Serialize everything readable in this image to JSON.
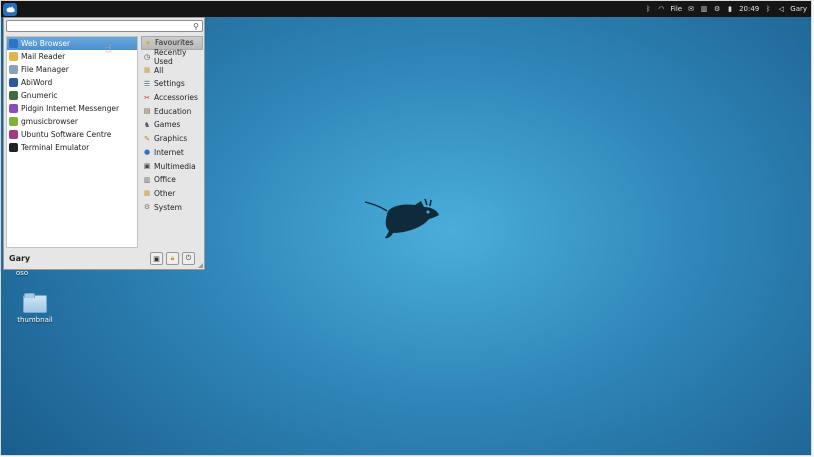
{
  "panel": {
    "menu_icon": "xfce-mouse-icon",
    "tray": {
      "file_label": "File",
      "clock": "20:49",
      "user": "Gary"
    }
  },
  "desktop": {
    "items": [
      {
        "label": "oso"
      },
      {
        "label": "thumbnail"
      }
    ]
  },
  "menu": {
    "search": {
      "value": "",
      "placeholder": ""
    },
    "apps": [
      {
        "label": "Web Browser",
        "icon": "globe-icon",
        "color": "#2f73c4"
      },
      {
        "label": "Mail Reader",
        "icon": "mail-icon",
        "color": "#e3b34a"
      },
      {
        "label": "File Manager",
        "icon": "folder-icon",
        "color": "#8aa1b8"
      },
      {
        "label": "AbiWord",
        "icon": "document-icon",
        "color": "#2b5b9a"
      },
      {
        "label": "Gnumeric",
        "icon": "spreadsheet-icon",
        "color": "#3e6e3e"
      },
      {
        "label": "Pidgin Internet Messenger",
        "icon": "pidgin-icon",
        "color": "#8a4fb5"
      },
      {
        "label": "gmusicbrowser",
        "icon": "music-icon",
        "color": "#7fb03a"
      },
      {
        "label": "Ubuntu Software Centre",
        "icon": "software-centre-icon",
        "color": "#a03a8a"
      },
      {
        "label": "Terminal Emulator",
        "icon": "terminal-icon",
        "color": "#222222"
      }
    ],
    "categories": [
      {
        "label": "Favourites",
        "icon": "star-icon",
        "glyph": "★",
        "color": "#e0a82e"
      },
      {
        "label": "Recently Used",
        "icon": "clock-icon",
        "glyph": "◷",
        "color": "#444444"
      },
      {
        "label": "All",
        "icon": "folder-icon",
        "glyph": "▦",
        "color": "#c9a24a"
      },
      {
        "label": "Settings",
        "icon": "settings-icon",
        "glyph": "☰",
        "color": "#5a6a7a"
      },
      {
        "label": "Accessories",
        "icon": "accessories-icon",
        "glyph": "✂",
        "color": "#c03030"
      },
      {
        "label": "Education",
        "icon": "education-icon",
        "glyph": "▤",
        "color": "#6b5a3a"
      },
      {
        "label": "Games",
        "icon": "games-icon",
        "glyph": "♞",
        "color": "#555555"
      },
      {
        "label": "Graphics",
        "icon": "graphics-icon",
        "glyph": "✎",
        "color": "#c07a20"
      },
      {
        "label": "Internet",
        "icon": "internet-icon",
        "glyph": "●",
        "color": "#2f73c4"
      },
      {
        "label": "Multimedia",
        "icon": "multimedia-icon",
        "glyph": "▣",
        "color": "#444444"
      },
      {
        "label": "Office",
        "icon": "office-icon",
        "glyph": "▥",
        "color": "#666666"
      },
      {
        "label": "Other",
        "icon": "other-icon",
        "glyph": "▦",
        "color": "#c9a24a"
      },
      {
        "label": "System",
        "icon": "system-icon",
        "glyph": "⚙",
        "color": "#777777"
      }
    ],
    "user": "Gary",
    "footer_buttons": [
      "settings-manager-icon",
      "lock-icon",
      "power-icon"
    ]
  }
}
